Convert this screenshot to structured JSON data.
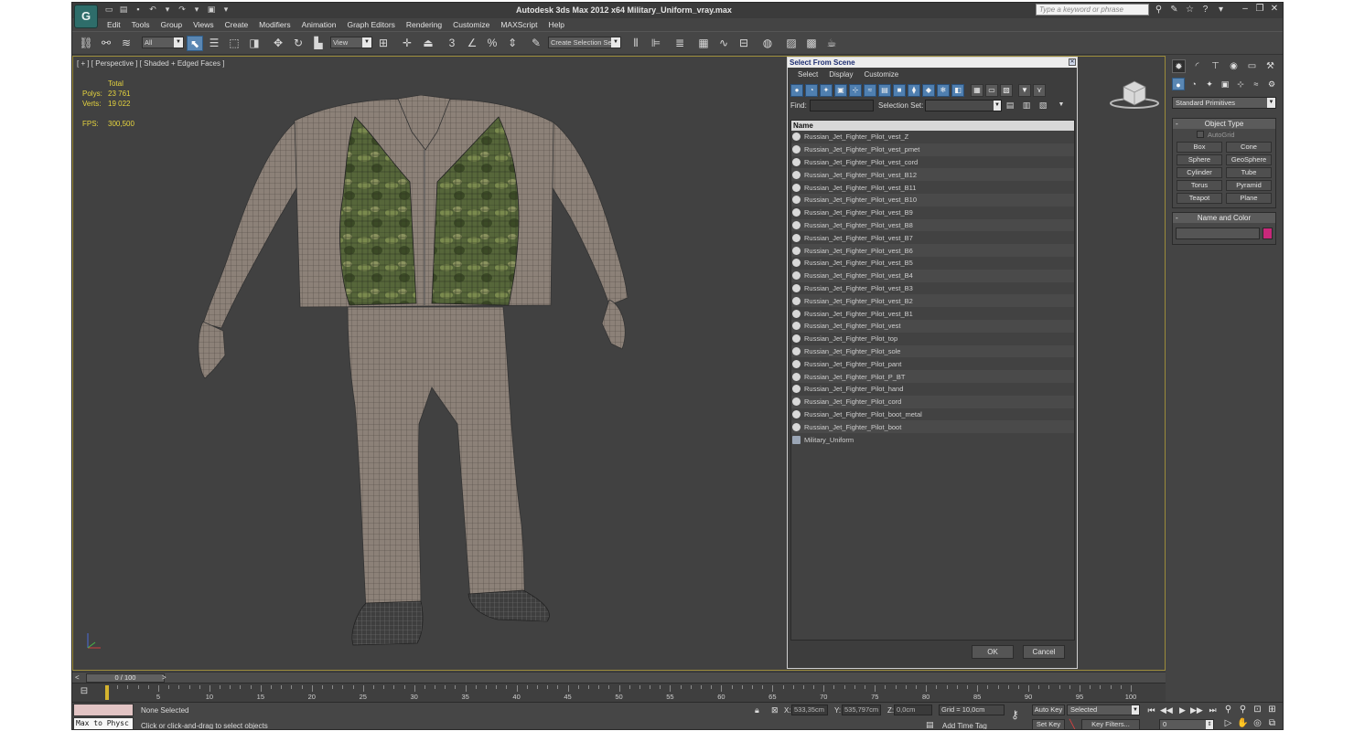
{
  "window": {
    "title": "Autodesk 3ds Max  2012 x64      Military_Uniform_vray.max",
    "search_placeholder": "Type a keyword or phrase",
    "logo_glyph": "G"
  },
  "menu": [
    "Edit",
    "Tools",
    "Group",
    "Views",
    "Create",
    "Modifiers",
    "Animation",
    "Graph Editors",
    "Rendering",
    "Customize",
    "MAXScript",
    "Help"
  ],
  "toolbar": {
    "filter": "All",
    "ref_coord": "View",
    "selection_set": "Create Selection Se"
  },
  "viewport": {
    "label": "[ + ] [ Perspective ] [ Shaded + Edged Faces ]",
    "stats_header": "Total",
    "polys_label": "Polys:",
    "polys_value": "23 761",
    "verts_label": "Verts:",
    "verts_value": "19 022",
    "fps_label": "FPS:",
    "fps_value": "300,500",
    "stats_color": "#e6d43f",
    "wire_color": "#8c8178",
    "vest_color": "#56663a"
  },
  "dialog": {
    "title": "Select From Scene",
    "menu": [
      "Select",
      "Display",
      "Customize"
    ],
    "find_label": "Find:",
    "selection_set_label": "Selection Set:",
    "column_name": "Name",
    "items": [
      "Russian_Jet_Fighter_Pilot_vest_Z",
      "Russian_Jet_Fighter_Pilot_vest_pmet",
      "Russian_Jet_Fighter_Pilot_vest_cord",
      "Russian_Jet_Fighter_Pilot_vest_B12",
      "Russian_Jet_Fighter_Pilot_vest_B11",
      "Russian_Jet_Fighter_Pilot_vest_B10",
      "Russian_Jet_Fighter_Pilot_vest_B9",
      "Russian_Jet_Fighter_Pilot_vest_B8",
      "Russian_Jet_Fighter_Pilot_vest_B7",
      "Russian_Jet_Fighter_Pilot_vest_B6",
      "Russian_Jet_Fighter_Pilot_vest_B5",
      "Russian_Jet_Fighter_Pilot_vest_B4",
      "Russian_Jet_Fighter_Pilot_vest_B3",
      "Russian_Jet_Fighter_Pilot_vest_B2",
      "Russian_Jet_Fighter_Pilot_vest_B1",
      "Russian_Jet_Fighter_Pilot_vest",
      "Russian_Jet_Fighter_Pilot_top",
      "Russian_Jet_Fighter_Pilot_sole",
      "Russian_Jet_Fighter_Pilot_pant",
      "Russian_Jet_Fighter_Pilot_P_BT",
      "Russian_Jet_Fighter_Pilot_hand",
      "Russian_Jet_Fighter_Pilot_cord",
      "Russian_Jet_Fighter_Pilot_boot_metal",
      "Russian_Jet_Fighter_Pilot_boot"
    ],
    "group_item": "Military_Uniform",
    "ok": "OK",
    "cancel": "Cancel"
  },
  "command_panel": {
    "primitives_dropdown": "Standard Primitives",
    "object_type_title": "Object Type",
    "autogrid_label": "AutoGrid",
    "objects": [
      "Box",
      "Cone",
      "Sphere",
      "GeoSphere",
      "Cylinder",
      "Tube",
      "Torus",
      "Pyramid",
      "Teapot",
      "Plane"
    ],
    "name_color_title": "Name and Color",
    "swatch_color": "#c8287a"
  },
  "timeline": {
    "frame_display": "0 / 100",
    "ticks": [
      5,
      10,
      15,
      20,
      25,
      30,
      35,
      40,
      45,
      50,
      55,
      60,
      65,
      70,
      75,
      80,
      85,
      90,
      95,
      100
    ]
  },
  "status": {
    "maxscript": "Max to Physc",
    "selection": "None Selected",
    "prompt": "Click or click-and-drag to select objects",
    "x_label": "X:",
    "x_value": "533,35cm",
    "y_label": "Y:",
    "y_value": "535,797cm",
    "z_label": "Z:",
    "z_value": "0,0cm",
    "grid": "Grid = 10,0cm",
    "add_time_tag": "Add Time Tag",
    "auto_key": "Auto Key",
    "set_key": "Set Key",
    "key_mode": "Selected",
    "key_filters": "Key Filters...",
    "current_frame": "0"
  }
}
